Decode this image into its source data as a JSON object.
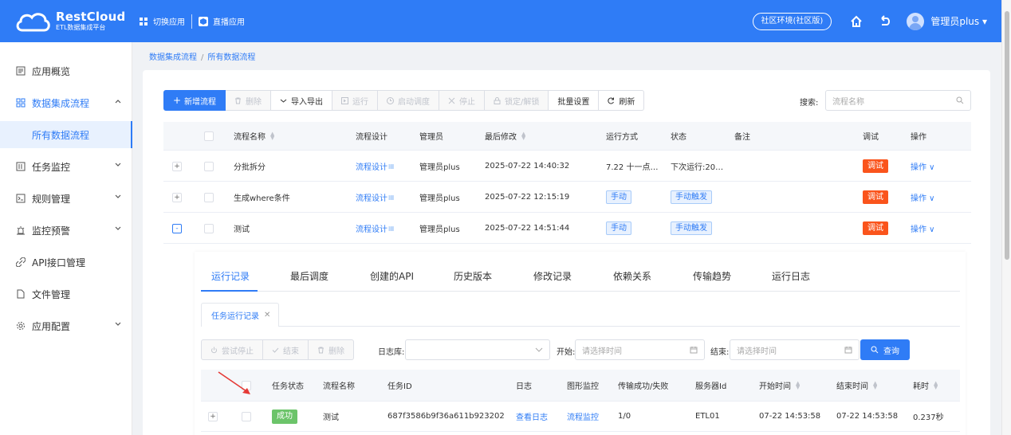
{
  "header": {
    "logo_title": "RestCloud",
    "logo_subtitle": "ETL数据集成平台",
    "switch_app": "切换应用",
    "live_app": "直播应用",
    "env": "社区环境(社区版)",
    "user": "管理员plus ▾",
    "accent": "#2f7cf6"
  },
  "sidebar": {
    "items": [
      {
        "label": "应用概览",
        "icon": "overview-icon"
      },
      {
        "label": "数据集成流程",
        "icon": "grid-icon"
      },
      {
        "label": "所有数据流程"
      },
      {
        "label": "任务监控",
        "icon": "monitor-icon"
      },
      {
        "label": "规则管理",
        "icon": "terminal-icon"
      },
      {
        "label": "监控预警",
        "icon": "alarm-icon"
      },
      {
        "label": "API接口管理",
        "icon": "link-icon"
      },
      {
        "label": "文件管理",
        "icon": "file-icon"
      },
      {
        "label": "应用配置",
        "icon": "gear-icon"
      }
    ]
  },
  "breadcrumb": {
    "root": "数据集成流程",
    "sep": "/",
    "current": "所有数据流程"
  },
  "toolbar": {
    "new": "新增流程",
    "delete": "删除",
    "import_export": "导入导出",
    "run": "运行",
    "schedule": "启动调度",
    "stop": "停止",
    "lock": "锁定/解锁",
    "batch": "批量设置",
    "refresh": "刷新"
  },
  "search": {
    "label": "搜索:",
    "placeholder": "流程名称"
  },
  "table": {
    "headers": {
      "name": "流程名称",
      "design": "流程设计",
      "owner": "管理员",
      "modified": "最后修改",
      "run_mode": "运行方式",
      "status": "状态",
      "remark": "备注",
      "debug": "调试",
      "ops": "操作"
    },
    "rows": [
      {
        "expand": "+",
        "name": "分批拆分",
        "design": "流程设计",
        "owner": "管理员plus",
        "modified": "2025-07-22 14:40:32",
        "run_mode": "7.22 十一点…",
        "status": "下次运行:20…",
        "debug": "调试",
        "ops": "操作 ∨"
      },
      {
        "expand": "+",
        "name": "生成where条件",
        "design": "流程设计",
        "owner": "管理员plus",
        "modified": "2025-07-22 12:15:19",
        "run_mode": "手动",
        "status": "手动触发",
        "debug": "调试",
        "ops": "操作 ∨"
      },
      {
        "expand": "-",
        "name": "测试",
        "design": "流程设计",
        "owner": "管理员plus",
        "modified": "2025-07-22 14:51:44",
        "run_mode": "手动",
        "status": "手动触发",
        "debug": "调试",
        "ops": "操作 ∨"
      }
    ]
  },
  "detail": {
    "tabs": [
      "运行记录",
      "最后调度",
      "创建的API",
      "历史版本",
      "修改记录",
      "依赖关系",
      "传输趋势",
      "运行日志"
    ],
    "subtab": "任务运行记录",
    "toolbar": {
      "try_stop": "尝试停止",
      "end": "结束",
      "delete": "删除"
    },
    "filters": {
      "log_db_label": "日志库:",
      "start_label": "开始:",
      "start_placeholder": "请选择时间",
      "end_label": "结束:",
      "end_placeholder": "请选择时间",
      "query": "查询"
    },
    "headers": {
      "status": "任务状态",
      "name": "流程名称",
      "task_id": "任务ID",
      "log": "日志",
      "graph": "图形监控",
      "transfer": "传输成功/失败",
      "server": "服务器Id",
      "start": "开始时间",
      "end": "结束时间",
      "cost": "耗时"
    },
    "rows": [
      {
        "expand": "+",
        "status": "成功",
        "name": "测试",
        "task_id": "687f3586b9f36a611b923202",
        "log": "查看日志",
        "graph": "流程监控",
        "transfer": "1/0",
        "server": "ETL01",
        "start": "07-22 14:53:58",
        "end": "07-22 14:53:58",
        "cost": "0.237秒"
      }
    ]
  }
}
